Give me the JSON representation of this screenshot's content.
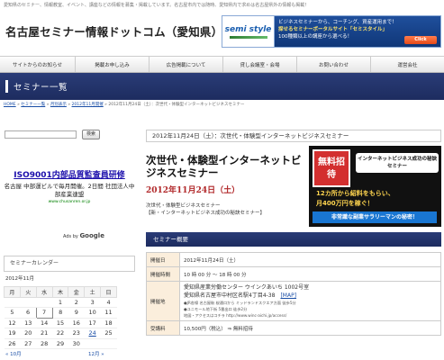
{
  "header": {
    "tagline": "愛知県のセミナー、情報教室、イベント、講座などの情報を募集・掲載しています。名古屋市内では随時、愛知県内で求めは名古屋県外の情報も掲載！",
    "site_title": "名古屋セミナー情報ドットコム（愛知県）"
  },
  "banner": {
    "logo": "semi style",
    "line1": "ビジネスセミナーから、コーチング、資産運用まで！",
    "line2": "探せるセミナーポータルサイト「セミスタイル」",
    "line3": "100種類以上の講座から選べる！",
    "click": "Click"
  },
  "nav": {
    "items": [
      "サイトからのお知らせ",
      "掲載お申し込み",
      "広告掲載について",
      "貸し会議室・会場",
      "お問い合わせ",
      "運営会社"
    ]
  },
  "hero": {
    "title": "セミナー一覧"
  },
  "breadcrumb": {
    "home": "HOME",
    "c1": "セミナー一覧",
    "c2": "月別表示",
    "c3": "2012年11月開催",
    "current": "2012年11月24日（土）：次世代・体験型インターネットビジネスセミナー"
  },
  "sidebar": {
    "search_button": "検索",
    "ad": {
      "title": "ISO9001内部品質監査員研修",
      "desc": "名古屋 中部運ビルで毎月開催。2日間 社団法人中部産業連盟",
      "url": "www.chusanren.or.jp"
    },
    "ads_by_prefix": "Ads by",
    "ads_by_brand": "Google",
    "calendar_title": "セミナーカレンダー",
    "calendar_month": "2012年11月",
    "weekdays": [
      "月",
      "火",
      "水",
      "木",
      "金",
      "土",
      "日"
    ],
    "weeks": [
      [
        "",
        "",
        "",
        "1",
        "2",
        "3",
        "4"
      ],
      [
        "5",
        "6",
        "7",
        "8",
        "9",
        "10",
        "11"
      ],
      [
        "12",
        "13",
        "14",
        "15",
        "16",
        "17",
        "18"
      ],
      [
        "19",
        "20",
        "21",
        "22",
        "23",
        "24",
        "25"
      ],
      [
        "26",
        "27",
        "28",
        "29",
        "30",
        "",
        ""
      ]
    ],
    "prev": "« 10月",
    "next": "12月 »"
  },
  "event": {
    "header": "2012年11月24日（土）：次世代・体験型インターネットビジネスセミナー",
    "title": "次世代・体験型インターネットビジネスセミナー",
    "date": "2012年11月24日（土）",
    "sub1": "次世代・体験型ビジネスセミナー",
    "sub2": "【新・インターネットビジネス成功の秘訣セミナー】"
  },
  "promo": {
    "badge": "無料招待",
    "headline": "インターネットビジネス成功の秘訣セミナー",
    "line1": "12カ所から紹料をもらい、",
    "line2": "月400万円を稼ぐ！",
    "line3": "非常識な副業サラリーマンの秘密！"
  },
  "overview": {
    "title": "セミナー概要",
    "rows": [
      {
        "label": "開催日",
        "value": "2012年11月24日（土）"
      },
      {
        "label": "開催時間",
        "value": "10 時 00 分 〜 18 時 00 分"
      }
    ],
    "venue_label": "開催地",
    "venue_line1": "愛知県産業労働センター ウインクあいち 1002号室",
    "venue_line2": "愛知県名古屋市中村区名駅4丁目4-38",
    "map": "[MAP]",
    "venue_notes": [
      "●JR各線 名古屋駅 桜通口から ミッドランドスクエア方面 徒歩5分",
      "●ユニモール地下街 5番出口 徒歩2分",
      "地図・アクセスはコチラ http://www.winc-aichi.jp/access/"
    ],
    "fee_label": "受講料",
    "fee_value": "10,500円（税込） ⇒ 無料招待"
  }
}
